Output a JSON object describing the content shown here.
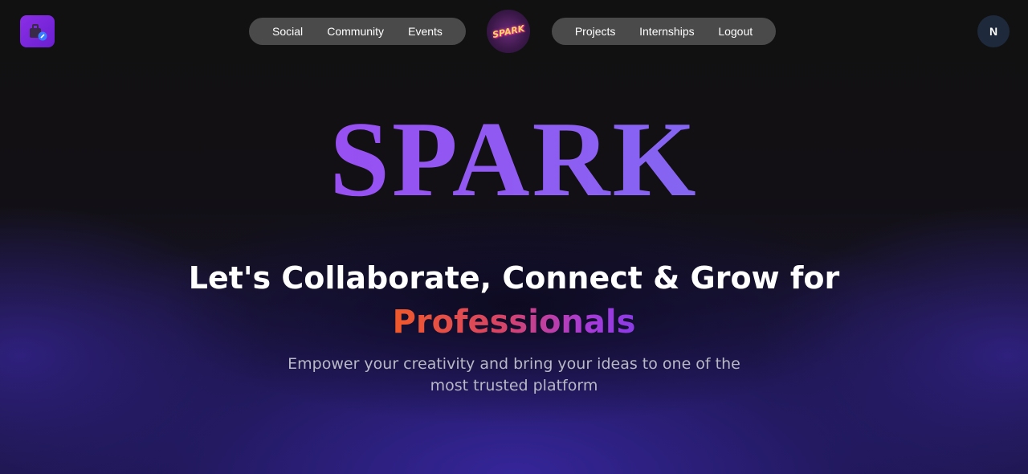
{
  "header": {
    "nav_left": [
      "Social",
      "Community",
      "Events"
    ],
    "nav_right": [
      "Projects",
      "Internships",
      "Logout"
    ],
    "logo_text": "SPARK",
    "avatar_initial": "N"
  },
  "hero": {
    "title": "SPARK",
    "tagline": "Let's Collaborate, Connect & Grow for",
    "highlight": "Professionals",
    "subtitle_line1": "Empower your creativity and bring your ideas to one of the",
    "subtitle_line2": "most trusted platform"
  },
  "icons": {
    "app_logo": "briefcase-app-icon",
    "center_logo": "spark-logo"
  },
  "colors": {
    "background": "#111111",
    "accent_purple": "#8b5cf6",
    "highlight_orange": "#f0592a",
    "highlight_purple": "#8a3be6",
    "pill_bg": "#4a4a4a"
  }
}
